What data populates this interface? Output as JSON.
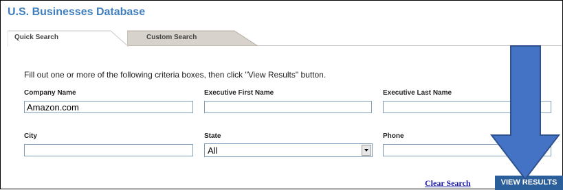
{
  "title": "U.S. Businesses Database",
  "tabs": [
    {
      "label": "Quick Search",
      "active": true
    },
    {
      "label": "Custom Search",
      "active": false
    }
  ],
  "instructions": "Fill out one or more of the following criteria boxes, then click \"View Results\" button.",
  "fields": {
    "company_name": {
      "label": "Company Name",
      "value": "Amazon.com"
    },
    "exec_first": {
      "label": "Executive First Name",
      "value": ""
    },
    "exec_last": {
      "label": "Executive Last Name",
      "value": ""
    },
    "city": {
      "label": "City",
      "value": ""
    },
    "state": {
      "label": "State",
      "value": "All"
    },
    "phone": {
      "label": "Phone",
      "value": ""
    }
  },
  "actions": {
    "clear": "Clear Search",
    "view": "VIEW RESULTS"
  },
  "colors": {
    "title": "#3f7fbf",
    "arrow": "#4472c4",
    "button": "#2a5f9b",
    "link": "#1a1aa6"
  },
  "icons": {
    "annotation": "down-arrow-icon",
    "select_dropdown": "chevron-down-icon"
  }
}
